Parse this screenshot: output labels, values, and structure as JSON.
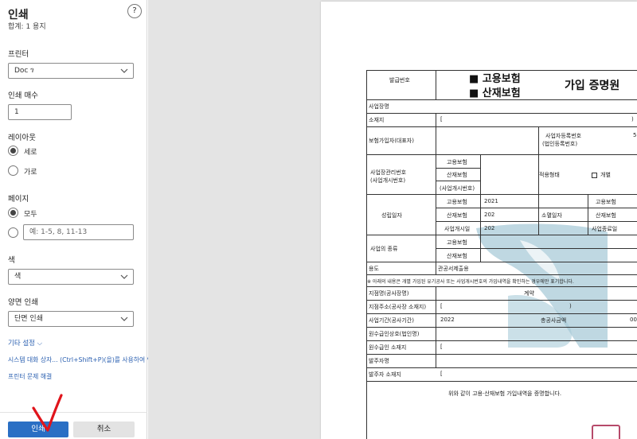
{
  "panel": {
    "title": "인쇄",
    "summary": "합계: 1 용지",
    "help_glyph": "?",
    "printer_label": "프린터",
    "printer_value": "Doc                    ገ",
    "copies_label": "인쇄 매수",
    "copies_value": "1",
    "layout_label": "레이아웃",
    "layout_options": [
      "세로",
      "가로"
    ],
    "pages_label": "페이지",
    "pages_all": "모두",
    "pages_placeholder": "예: 1-5, 8, 11-13",
    "color_label": "색",
    "color_value": "색",
    "duplex_label": "양면 인쇄",
    "duplex_value": "단면 인쇄",
    "more_settings": "기타 설정 ⌵",
    "system_dialog": "시스템 대화 상자... (Ctrl+Shift+P)(을)를 사용하여 인",
    "troubleshoot": "프린터 문제 해결",
    "print_button": "인쇄",
    "cancel_button": "취소"
  },
  "doc": {
    "issue_no": "발급번호",
    "ins_employment": "■ 고용보험",
    "ins_accident": "■ 산재보험",
    "cert_title": "가입 증명원",
    "workplace_name": "사업장명",
    "address": "소재지",
    "address_bracket": "[",
    "insured_rep": "보험가입자(대표자)",
    "bizreg_no": "사업자등록번호",
    "corp_reg_no": "(법인등록번호)",
    "mgmt_no": "사업장관리번호",
    "opening_no": "(사업개시번호)",
    "employment_ins": "고용보험",
    "accident_ins": "산재보험",
    "opening_no_paren": "(사업개시번호)",
    "app_type": "적용형태",
    "individual": "개별",
    "established": "성립일자",
    "year_1": "2021",
    "year_2": "202",
    "year_3": "202",
    "extinction": "소멸일자",
    "biz_start_date": "사업개시일",
    "biz_end_date": "사업종료일",
    "biz_type": "사업의 종류",
    "purpose": "용도",
    "customs_submit": "관공서제출용",
    "note": "※ 아래의 내용은 개별 가입된 유기공사 또는 사업개시번호의 가입내역을 확인하는 경우에만 표기합니다.",
    "site_name": "지점명(공사장명)",
    "contract": "계약",
    "site_address": "지점주소(공사장 소재지)",
    "site_period": "사업기간(공사기간)",
    "period_year": "2022",
    "total_amount": "총공사금액",
    "amount_frag": "00",
    "contractor_name": "원수급인상호(법인명)",
    "contractor_address": "원수급인 소재지",
    "orderer_name": "발주자명",
    "orderer_address": "발주자 소재지",
    "confirm": "위와 같이 고용·산재보험 가입내역을 증명합니다.",
    "bracket_close": ")",
    "frag_5": "5"
  },
  "colors": {
    "accent": "#2a6fc4",
    "link": "#2a5fb0",
    "watermark": "#a9cbd8",
    "annotation": "#e0141b",
    "stamp": "#b64a6a"
  }
}
